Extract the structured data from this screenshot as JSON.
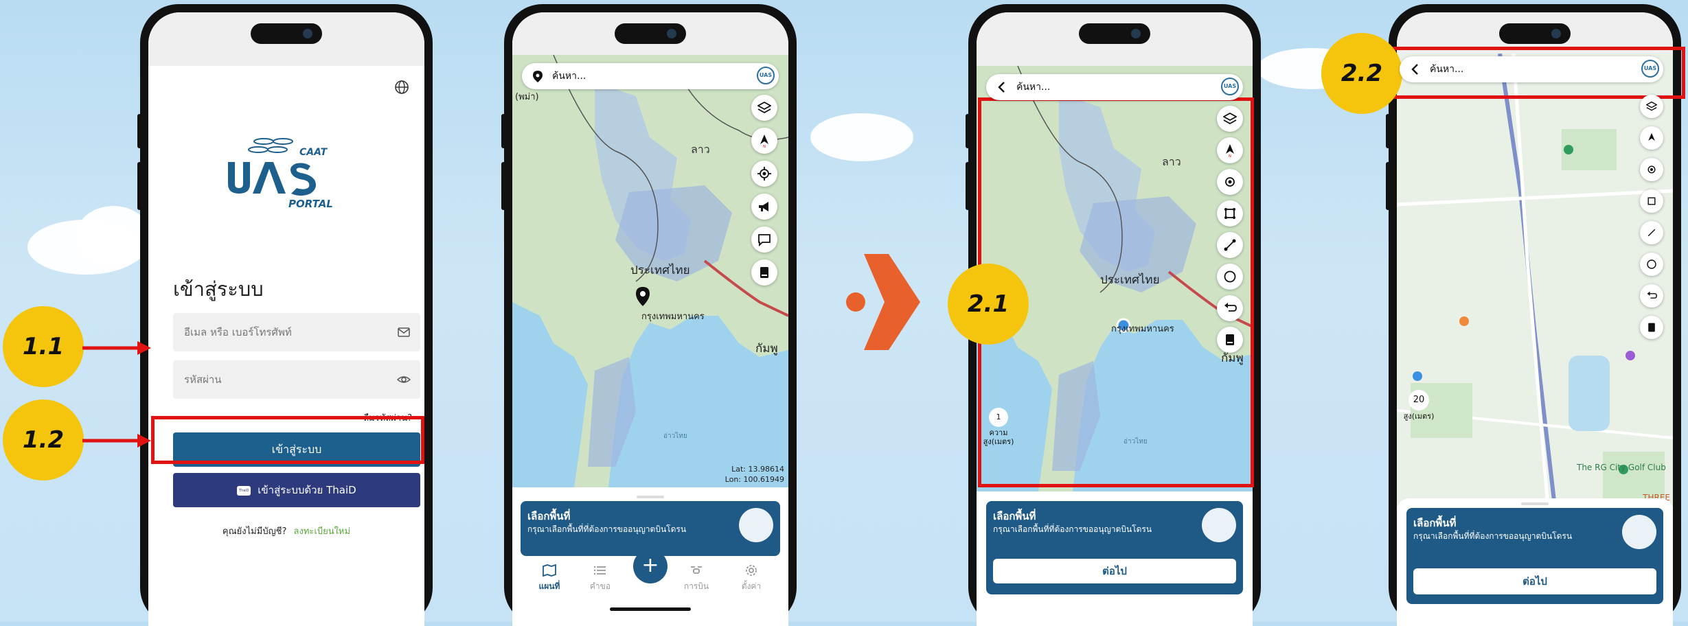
{
  "step_labels": [
    "1.1",
    "1.2",
    "2.1",
    "2.2"
  ],
  "login_screen": {
    "title": "เข้าสู่ระบบ",
    "email_placeholder": "อีเมล หรือ เบอร์โทรศัพท์",
    "password_placeholder": "รหัสผ่าน",
    "forgot_password": "ลืมรหัสผ่าน?",
    "login_button": "เข้าสู่ระบบ",
    "thaid_button": "เข้าสู่ระบบด้วย ThaiD",
    "thaid_badge": "ThaiD",
    "no_account": "คุณยังไม่มีบัญชี?",
    "register_link": "ลงทะเบียนใหม่",
    "logo": {
      "line1": "CAAT",
      "line2": "UAS",
      "line3": "PORTAL"
    }
  },
  "map_home_screen": {
    "search_placeholder": "ค้นหา...",
    "coordinates": {
      "lat": "Lat: 13.98614",
      "lon": "Lon: 100.61949"
    },
    "map_labels": [
      "ลาว",
      "ประเทศไทย",
      "กรุงเทพมหานคร",
      "กัมพู",
      "(พม่า)",
      "อ่าวไทย"
    ],
    "card_title": "เลือกพื้นที่",
    "card_subtitle": "กรุณาเลือกพื้นที่ที่ต้องการขออนุญาตบินโดรน",
    "bottom_nav": [
      {
        "label": "แผนที่",
        "icon": "map-icon"
      },
      {
        "label": "คำขอ",
        "icon": "list-icon"
      },
      {
        "label": "",
        "icon": "plus-icon"
      },
      {
        "label": "การบิน",
        "icon": "drone-icon"
      },
      {
        "label": "ตั้งค่า",
        "icon": "settings-icon"
      }
    ]
  },
  "area_select_screen": {
    "search_placeholder": "ค้นหา...",
    "map_labels": [
      "ลาว",
      "ประเทศไทย",
      "กรุงเทพมหานคร",
      "กัมพู",
      "อ่าวไทย"
    ],
    "scale_value": "1",
    "scale_unit": "ความ\nสูง(เมตร)",
    "card_title": "เลือกพื้นที่",
    "card_subtitle": "กรุณาเลือกพื้นที่ที่ต้องการขออนุญาตบินโดรน",
    "next_button": "ต่อไป"
  },
  "zoomed_screen": {
    "search_placeholder": "ค้นหา...",
    "altitude_value": "20",
    "altitude_unit": "สูง(เมตร)",
    "map_labels": [
      "The RG City Golf Club",
      "THREE"
    ],
    "card_title": "เลือกพื้นที่",
    "card_subtitle": "กรุณาเลือกพื้นที่ที่ต้องการขออนุญาตบินโดรน",
    "next_button": "ต่อไป"
  },
  "colors": {
    "accent": "#1d5f8d",
    "thaid": "#2e3a7e",
    "callout": "#f5c50d",
    "highlight": "#e01212",
    "arrow": "#e8612c",
    "register_link": "#5aa93c"
  }
}
